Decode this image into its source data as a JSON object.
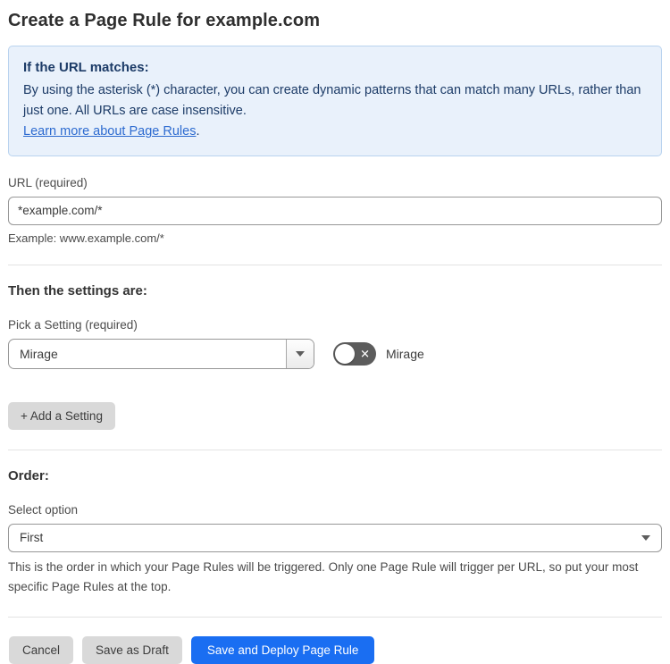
{
  "page": {
    "title": "Create a Page Rule for example.com"
  },
  "info_box": {
    "heading": "If the URL matches:",
    "body": "By using the asterisk (*) character, you can create dynamic patterns that can match many URLs, rather than just one. All URLs are case insensitive.",
    "link_label": "Learn more about Page Rules",
    "link_suffix": "."
  },
  "url_field": {
    "label": "URL (required)",
    "value": "*example.com/*",
    "helper": "Example: www.example.com/*"
  },
  "settings_section": {
    "heading": "Then the settings are:",
    "setting_label": "Pick a Setting (required)",
    "setting_value": "Mirage",
    "toggle": {
      "state": "off",
      "glyph": "✕",
      "label": "Mirage"
    },
    "add_button_label": "+ Add a Setting"
  },
  "order_section": {
    "heading": "Order:",
    "label": "Select option",
    "value": "First",
    "helper": "This is the order in which your Page Rules will be triggered. Only one Page Rule will trigger per URL, so put your most specific Page Rules at the top."
  },
  "footer": {
    "cancel_label": "Cancel",
    "save_draft_label": "Save as Draft",
    "save_deploy_label": "Save and Deploy Page Rule"
  },
  "colors": {
    "info_box_background": "#e9f1fb",
    "info_box_border": "#b9d3ef",
    "info_text": "#1c3b67",
    "link": "#2d6bd0",
    "primary_button": "#1a6ef2",
    "gray_button": "#d9d9d9",
    "toggle_off": "#5c5c5c",
    "input_border": "#979797",
    "divider": "#e3e3e3"
  }
}
